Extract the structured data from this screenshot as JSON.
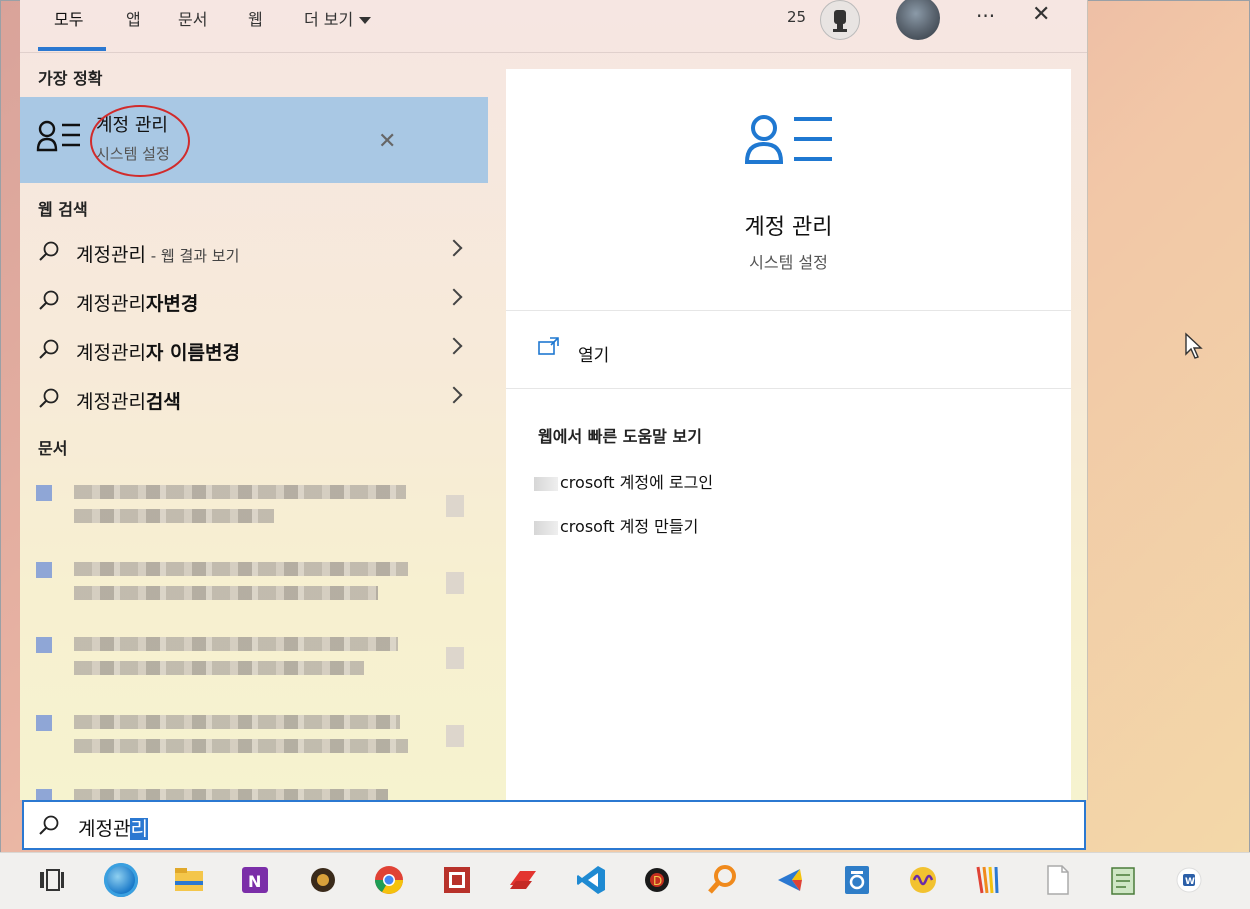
{
  "tabs": [
    {
      "label": "모두",
      "active": true
    },
    {
      "label": "앱",
      "active": false
    },
    {
      "label": "문서",
      "active": false
    },
    {
      "label": "웹",
      "active": false
    },
    {
      "label": "더 보기",
      "active": false
    }
  ],
  "top_right": {
    "points": "25",
    "more_label": "···",
    "close_label": "✕"
  },
  "best_match": {
    "section_title": "가장 정확",
    "title": "계정 관리",
    "subtitle": "시스템 설정",
    "remove_label": "✕"
  },
  "web_search": {
    "section_title": "웹 검색",
    "items": [
      {
        "query": "계정관리",
        "bold_suffix": "",
        "hint": " - 웹 결과 보기"
      },
      {
        "query": "계정관리",
        "bold_suffix": "자변경",
        "hint": ""
      },
      {
        "query": "계정관리",
        "bold_suffix": "자 이름변경",
        "hint": ""
      },
      {
        "query": "계정관리",
        "bold_suffix": "검색",
        "hint": ""
      }
    ]
  },
  "documents": {
    "section_title": "문서"
  },
  "preview": {
    "title": "계정 관리",
    "subtitle": "시스템 설정",
    "open_label": "열기",
    "help_title": "웹에서 빠른 도움말 보기",
    "help_links": [
      "crosoft 계정에 로그인",
      "crosoft 계정 만들기"
    ]
  },
  "search": {
    "typed": "계정관",
    "selected": "리"
  },
  "colors": {
    "accent": "#2b78d1",
    "highlight_ring": "#d12b2b",
    "best_match_bg": "#a9c8e4"
  },
  "taskbar_icons": [
    "task-view-icon",
    "edge-icon",
    "file-explorer-icon",
    "onenote-icon",
    "diablo-icon",
    "chrome-icon",
    "screenshot-icon",
    "anydesk-icon",
    "vscode-icon",
    "diablo-launcher-icon",
    "magnifier-icon",
    "app-icon",
    "hwp-icon",
    "audio-icon",
    "paint-icon",
    "document-icon",
    "notepad-icon",
    "word-icon"
  ]
}
